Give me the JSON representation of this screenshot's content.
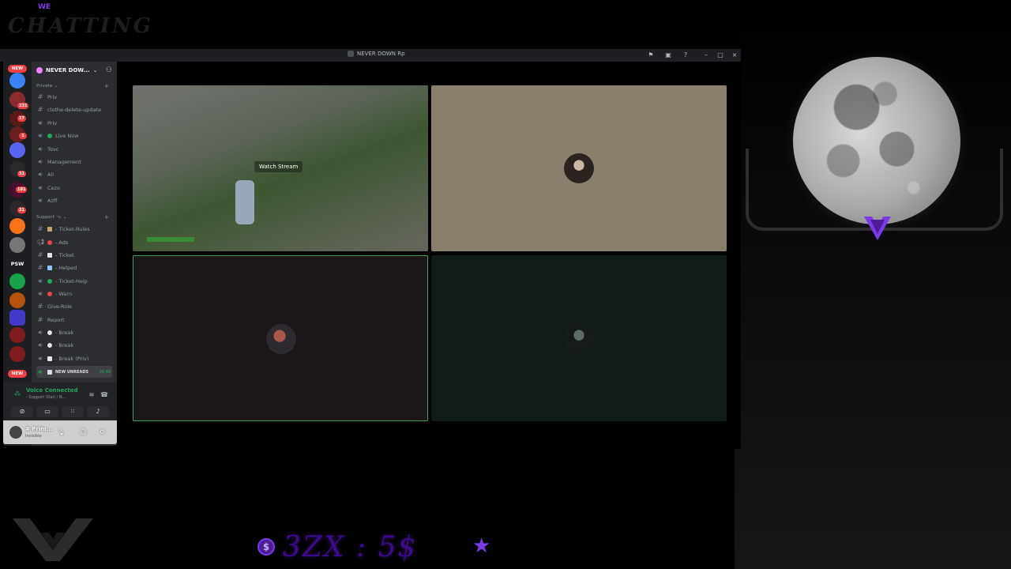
{
  "branding": {
    "corner_tag": "WE",
    "corner_word": "CHATTING"
  },
  "window": {
    "title": "NEVER DOWN Rp"
  },
  "server": {
    "name": "NEVER DOW...",
    "categories": [
      {
        "label": "Private",
        "channels": [
          {
            "label": "Priv",
            "type": "text"
          },
          {
            "label": "clothe-delete-update",
            "type": "text"
          },
          {
            "label": "Priv",
            "type": "voice"
          },
          {
            "label": "Live Now",
            "type": "voice",
            "emoji_color": "#23a55a"
          },
          {
            "label": "Tovc",
            "type": "voice"
          },
          {
            "label": "Management",
            "type": "voice"
          },
          {
            "label": "Ali",
            "type": "voice"
          },
          {
            "label": "Cezo",
            "type": "voice"
          },
          {
            "label": "Azff",
            "type": "voice"
          }
        ]
      },
      {
        "label": "Support ⌥",
        "channels": [
          {
            "label": "- Ticket-Rules",
            "type": "text"
          },
          {
            "label": "- Ads",
            "type": "voice"
          },
          {
            "label": "- Ticket",
            "type": "text"
          },
          {
            "label": "- Helped",
            "type": "text"
          },
          {
            "label": "- Ticket-Help",
            "type": "voice",
            "emoji_color": "#23a55a"
          },
          {
            "label": "- Warn",
            "type": "voice",
            "emoji_color": "#f23f43"
          },
          {
            "label": "Give-Role",
            "type": "text"
          },
          {
            "label": "Report",
            "type": "text"
          },
          {
            "label": "- Break",
            "type": "voice"
          },
          {
            "label": "- Break",
            "type": "voice"
          },
          {
            "label": "- Break (Priv)",
            "type": "voice"
          },
          {
            "label": "NEW UNREADS",
            "type": "voice",
            "active": true,
            "time": "36:48"
          }
        ]
      }
    ]
  },
  "rail": {
    "new_label": "NEW",
    "badges": [
      "231",
      "17",
      "1",
      "31",
      "181",
      "31"
    ],
    "psw_label": "PSW"
  },
  "voice": {
    "status": "Voice Connected",
    "channel": "- Support (Dai) / N..."
  },
  "user": {
    "name": "# Prim...",
    "status": "Invisible"
  },
  "stream": {
    "watch_label": "Watch Stream"
  },
  "tiles_colors": {
    "tile2_bg": "#8a7f6c",
    "tile3_bg": "#1b1719",
    "tile4_bg": "#0f1a19",
    "speaking_border": "#3ba55c"
  },
  "footer": {
    "price_text": "3ZX : 5$"
  },
  "accent": "#7c3aed"
}
